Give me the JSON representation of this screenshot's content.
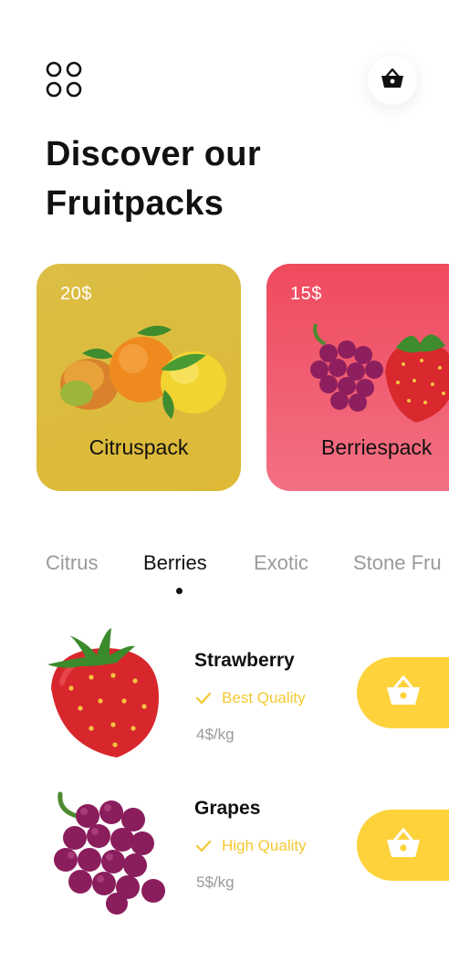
{
  "header": {
    "title_line1": "Discover our",
    "title_line2": "Fruitpacks",
    "menu_icon": "grid-circles-icon",
    "cart_icon": "basket-icon"
  },
  "packs": [
    {
      "name": "Citruspack",
      "price": "20$",
      "color": "#dbbb3e"
    },
    {
      "name": "Berriespack",
      "price": "15$",
      "color": "#f05a6e"
    }
  ],
  "categories": {
    "items": [
      "Citrus",
      "Berries",
      "Exotic",
      "Stone Fru"
    ],
    "active": "Berries"
  },
  "products": [
    {
      "name": "Strawberry",
      "quality": "Best Quality",
      "price": "4$/kg",
      "icon": "strawberry-icon"
    },
    {
      "name": "Grapes",
      "quality": "High Quality",
      "price": "5$/kg",
      "icon": "grapes-icon"
    }
  ],
  "colors": {
    "accent_yellow": "#fdd23b",
    "quality_text": "#f4c832",
    "muted_text": "#9a9a9a"
  }
}
